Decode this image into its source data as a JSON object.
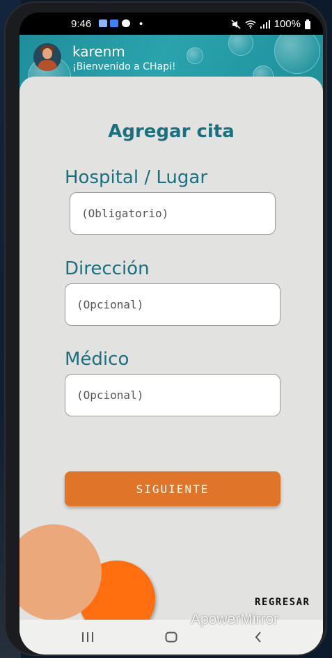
{
  "status": {
    "time": "9:46",
    "battery": "100%"
  },
  "header": {
    "username": "karenm",
    "welcome": "¡Bienvenido a CHapi!"
  },
  "form": {
    "title": "Agregar cita",
    "fields": [
      {
        "label": "Hospital / Lugar",
        "placeholder": "(Obligatorio)",
        "value": ""
      },
      {
        "label": "Dirección",
        "placeholder": "(Opcional)",
        "value": ""
      },
      {
        "label": "Médico",
        "placeholder": "(Opcional)",
        "value": ""
      }
    ],
    "next_label": "SIGUIENTE",
    "back_label": "REGRESAR"
  },
  "watermark": "ApowerMirror",
  "colors": {
    "teal": "#1c6f7e",
    "header": "#2aa3ad",
    "orange": "#e07428",
    "card": "#e2e3e1"
  }
}
